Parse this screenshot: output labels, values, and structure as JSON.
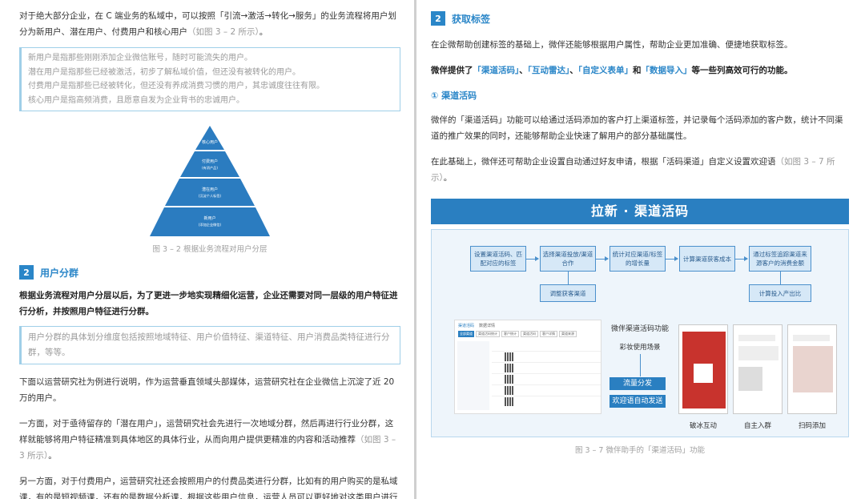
{
  "left": {
    "intro": "对于绝大部分企业，在 C 端业务的私域中，可以按照「引流→激活→转化→服务」的业务流程将用户划分为新用户、潜在用户、付费用户和核心用户",
    "intro_ref": "（如图 3 – 2 所示）",
    "intro_end": "。",
    "quote_lines": [
      "新用户是指那些刚刚添加企业微信账号，随时可能流失的用户。",
      "潜在用户是指那些已经被激活，初步了解私域价值，但还没有被转化的用户。",
      "付费用户是指那些已经被转化，但还没有养成消费习惯的用户，其忠诚度往往有限。",
      "核心用户是指高频消费，且愿意自发为企业背书的忠诚用户。"
    ],
    "pyramid": [
      {
        "label": "核心用户",
        "sub": ""
      },
      {
        "label": "付费用户",
        "sub": "(有消产品)"
      },
      {
        "label": "潜在用户",
        "sub": "(沉淀个人标签)"
      },
      {
        "label": "新用户",
        "sub": "(添加企业微信)"
      }
    ],
    "figure_caption": "图 3 – 2 根据业务流程对用户分层",
    "section2_num": "2",
    "section2_title": "用户分群",
    "section2_bold": "根据业务流程对用户分层以后，为了更进一步地实现精细化运营，企业还需要对同一层级的用户特征进行分析，并按照用户特征进行分群。",
    "quote2": "用户分群的具体划分维度包括按照地域特征、用户价值特征、渠道特征、用户消费品类特征进行分群，等等。",
    "para_a": "下面以运营研究社为例进行说明，作为运营垂直领域头部媒体，运营研究社在企业微信上沉淀了近 20 万的用户。",
    "para_b": "一方面，对于亟待留存的「潜在用户」，运营研究社会先进行一次地域分群，然后再进行行业分群，这样就能够将用户特征精准到具体地区的具体行业，从而向用户提供更精准的内容和活动推荐",
    "para_b_ref": "（如图 3 – 3 所示）",
    "para_b_end": "。",
    "para_c": "另一方面，对于付费用户，运营研究社还会按照用户的付费品类进行分群，比如有的用户购买的是私域课，有的是短视频课，还有的是数据分析课，根据这些用户信息，运营人员可以更好地对这类用户进行服务和复购引导。"
  },
  "right": {
    "section_num": "2",
    "section_title": "获取标签",
    "p1": "在企微帮助创建标签的基础上，微伴还能够根据用户属性，帮助企业更加准确、便捷地获取标签。",
    "p2_prefix": "微伴提供了",
    "p2_items": [
      "「渠道活码」",
      "「互动雷达」",
      "「自定义表单」",
      "「数据导入」"
    ],
    "p2_seps": [
      "、",
      "、",
      "和"
    ],
    "p2_suffix": "等一些列高效可行的功能。",
    "sub_title": "① 渠道活码",
    "p3": "微伴的「渠道活码」功能可以给通过活码添加的客户打上渠道标签，并记录每个活码添加的客户数，统计不同渠道的推广效果的同时，还能够帮助企业快速了解用户的部分基础属性。",
    "p4": "在此基础上，微伴还可帮助企业设置自动通过好友申请，根据「活码渠道」自定义设置欢迎语",
    "p4_ref": "（如图 3 – 7 所示）",
    "p4_end": "。",
    "banner": "拉新 · 渠道活码",
    "flow": [
      "设置渠道活码、匹配对应的标签",
      "选择渠道投放/渠道合作",
      "统计对应渠道/标签的增长量",
      "计算渠道获客成本",
      "通过标签追踪渠道来源客户的消费金额"
    ],
    "flow_down_left": "调整获客渠道",
    "flow_down_right": "计算投入产出比",
    "feature_title": "微伴渠道活码功能",
    "feature_sub": "彩妆使用场景",
    "feature_btn1": "流量分发",
    "feature_btn2": "欢迎语自动发送",
    "phone_labels": [
      "破冰互动",
      "自主入群",
      "扫码添加"
    ],
    "figure_caption": "图 3 – 7 微伴助手的「渠道活码」功能",
    "mini_tabs": [
      "渠道活码",
      "数据详情"
    ],
    "mini_filters": [
      "全部渠道",
      "渠道活码统计",
      "客户统计",
      "渠道活码",
      "客户详情",
      "渠道来源"
    ]
  }
}
